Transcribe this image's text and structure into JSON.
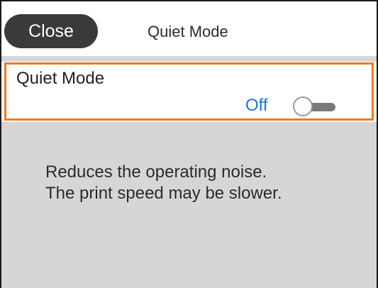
{
  "header": {
    "close_label": "Close",
    "title": "Quiet Mode"
  },
  "setting": {
    "label": "Quiet Mode",
    "value": "Off",
    "toggle_on": false
  },
  "description": {
    "line1": "Reduces the operating noise.",
    "line2": "The print speed may be slower."
  },
  "colors": {
    "accent": "#f07a1e",
    "value_text": "#1a73e8",
    "close_button": "#3a3a3a",
    "background_panel": "#d6d6d6"
  }
}
